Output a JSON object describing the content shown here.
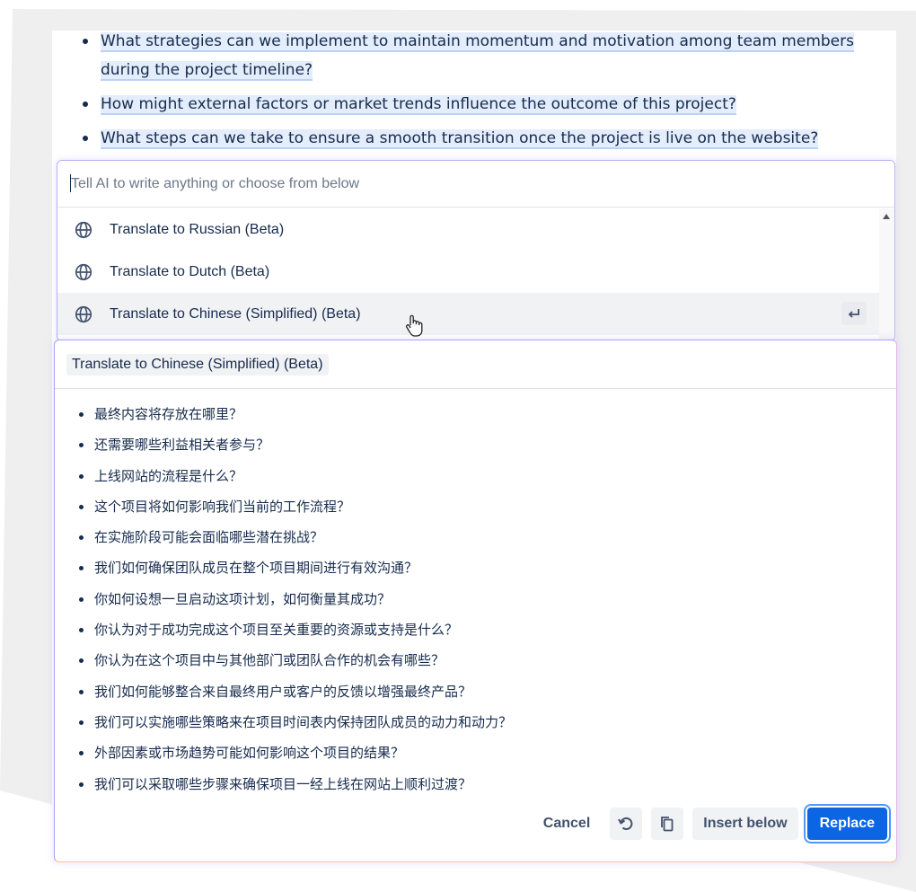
{
  "questions": [
    "What strategies can we implement to maintain momentum and motivation among team members during the project timeline?",
    "How might external factors or market trends influence the outcome of this project?",
    "What steps can we take to ensure a smooth transition once the project is live on the website?"
  ],
  "prompt": {
    "placeholder": "Tell AI to write anything or choose from below",
    "value": ""
  },
  "menu": {
    "items": [
      {
        "label": "Translate to Russian (Beta)",
        "icon": "globe-icon"
      },
      {
        "label": "Translate to Dutch (Beta)",
        "icon": "globe-icon"
      },
      {
        "label": "Translate to Chinese (Simplified) (Beta)",
        "icon": "globe-icon"
      }
    ],
    "active_index": 2,
    "enter_icon": "enter-key-icon"
  },
  "result": {
    "tag": "Translate to Chinese (Simplified) (Beta)",
    "items": [
      "最终内容将存放在哪里？",
      "还需要哪些利益相关者参与？",
      "上线网站的流程是什么？",
      "这个项目将如何影响我们当前的工作流程？",
      "在实施阶段可能会面临哪些潜在挑战？",
      "我们如何确保团队成员在整个项目期间进行有效沟通？",
      "你如何设想一旦启动这项计划，如何衡量其成功？",
      "你认为对于成功完成这个项目至关重要的资源或支持是什么？",
      "你认为在这个项目中与其他部门或团队合作的机会有哪些？",
      "我们如何能够整合来自最终用户或客户的反馈以增强最终产品？",
      "我们可以实施哪些策略来在项目时间表内保持团队成员的动力和动力？",
      "外部因素或市场趋势可能如何影响这个项目的结果？",
      "我们可以采取哪些步骤来确保项目一经上线在网站上顺利过渡？"
    ],
    "actions": {
      "cancel": "Cancel",
      "retry_icon": "retry-icon",
      "copy_icon": "copy-icon",
      "insert_below": "Insert below",
      "replace": "Replace"
    }
  },
  "colors": {
    "primary": "#0c66e4",
    "highlight": "#e3edfb",
    "text": "#172b4d"
  }
}
